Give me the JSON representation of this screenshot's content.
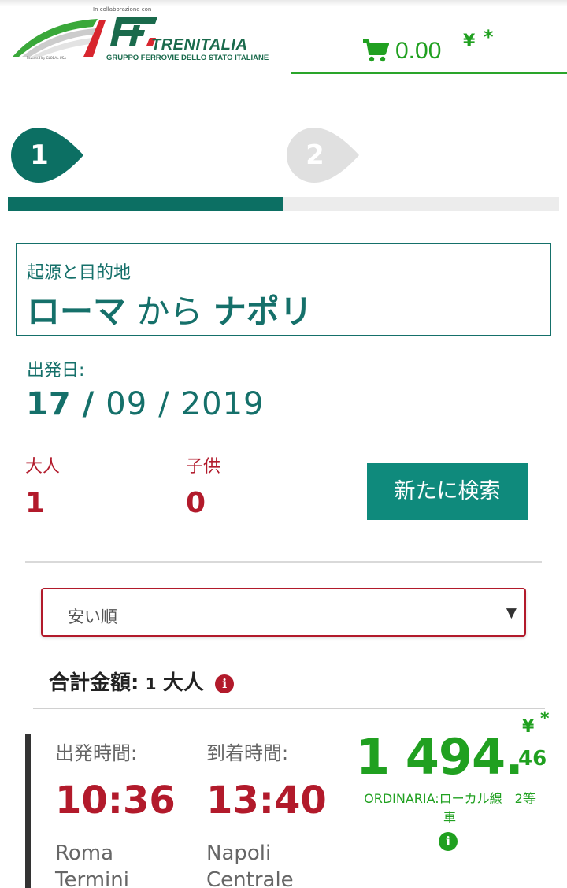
{
  "header": {
    "logo_collab": "In collaborazione con",
    "logo_brand": "TRENITALIA",
    "logo_sub": "GRUPPO FERROVIE DELLO STATO ITALIANE",
    "logo_powered": "Powered by GLOBAL USA",
    "cart_amount": "0.00",
    "cart_currency": "¥",
    "cart_star": "*",
    "colors": {
      "brand_green": "#1a6a4c",
      "cart_green": "#20a020"
    }
  },
  "steps": [
    {
      "number": "1",
      "state": "active",
      "color": "#0c6f63"
    },
    {
      "number": "2",
      "state": "inactive",
      "color": "#e0e0e0"
    }
  ],
  "progress": {
    "fraction": 0.5
  },
  "route": {
    "label": "起源と目的地",
    "origin": "ローマ",
    "connector": "から",
    "destination": "ナポリ"
  },
  "departure_date": {
    "label": "出発日:",
    "day": "17",
    "sep1": "/",
    "month": "09",
    "sep2": "/",
    "year": "2019"
  },
  "passengers": {
    "adults_label": "大人",
    "adults_value": "1",
    "children_label": "子供",
    "children_value": "0"
  },
  "new_search_label": "新たに検索",
  "sort": {
    "selected": "安い順",
    "caret": "▼"
  },
  "total": {
    "label": "合計金額:",
    "count": "1",
    "unit": "大人",
    "info_icon": "i"
  },
  "train": {
    "departure_label": "出発時間:",
    "arrival_label": "到着時間:",
    "departure_time": "10:36",
    "arrival_time": "13:40",
    "departure_station": "Roma Termini",
    "arrival_station": "Napoli Centrale",
    "price_main": "1 494.",
    "price_decimal": "46",
    "price_currency": "¥",
    "price_star": "*",
    "fare_class": "ORDINARIA:ローカル線　2等車",
    "info_icon": "i"
  }
}
